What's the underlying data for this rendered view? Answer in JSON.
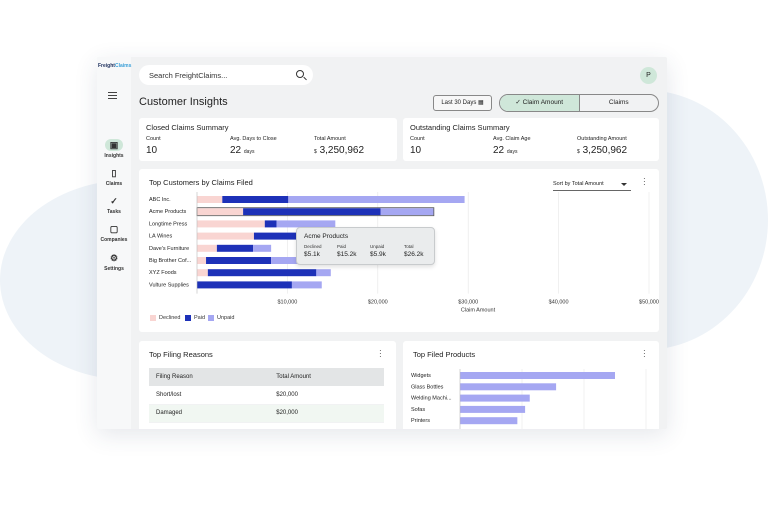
{
  "app": {
    "logo_text": "Freight",
    "logo_accent": "Claims"
  },
  "sidebar": {
    "items": [
      {
        "label": "Insights",
        "icon": "chart-icon",
        "active": true
      },
      {
        "label": "Claims",
        "icon": "clipboard-icon",
        "active": false
      },
      {
        "label": "Tasks",
        "icon": "check-icon",
        "active": false
      },
      {
        "label": "Companies",
        "icon": "briefcase-icon",
        "active": false
      },
      {
        "label": "Settings",
        "icon": "gear-icon",
        "active": false
      }
    ]
  },
  "header": {
    "search_placeholder": "Search FreightClaims...",
    "avatar_initial": "P"
  },
  "page": {
    "title": "Customer Insights",
    "date_range": "Last 30 Days",
    "toggle": {
      "active": "Claim Amount",
      "inactive": "Claims"
    }
  },
  "closed_summary": {
    "title": "Closed Claims Summary",
    "count_label": "Count",
    "count_value": "10",
    "avg_label": "Avg. Days to Close",
    "avg_value": "22",
    "avg_unit": "days",
    "total_label": "Total Amount",
    "total_currency": "$",
    "total_value": "3,250,962"
  },
  "outstanding_summary": {
    "title": "Outstanding Claims Summary",
    "count_label": "Count",
    "count_value": "10",
    "age_label": "Avg. Claim Age",
    "age_value": "22",
    "age_unit": "days",
    "amount_label": "Outstanding Amount",
    "amount_currency": "$",
    "amount_value": "3,250,962"
  },
  "top_customers": {
    "title": "Top Customers by Claims Filed",
    "sort_label": "Sort by Total Amount"
  },
  "chart_data": [
    {
      "type": "bar",
      "orientation": "horizontal",
      "stacked": true,
      "title": "Top Customers by Claims Filed",
      "xlabel": "Claim Amount",
      "ylabel": "",
      "categories": [
        "ABC Inc.",
        "Acme Products",
        "Longtime Press",
        "LA Wines",
        "Dave's Furniture",
        "Big Brother Cof...",
        "XYZ Foods",
        "Vulture Supplies"
      ],
      "series": [
        {
          "name": "Declined",
          "color": "#f9d5d2",
          "values": [
            2800,
            5100,
            7500,
            6300,
            2200,
            1000,
            1200,
            0
          ]
        },
        {
          "name": "Paid",
          "color": "#1d31b8",
          "values": [
            7300,
            15200,
            1300,
            6800,
            4000,
            7200,
            12000,
            10500
          ]
        },
        {
          "name": "Unpaid",
          "color": "#a5a7f2",
          "values": [
            19500,
            5900,
            6500,
            2400,
            2000,
            4700,
            1600,
            3300
          ]
        }
      ],
      "xlim": [
        0,
        50000
      ],
      "xticks": [
        "$10,000",
        "$20,000",
        "$30,000",
        "$40,000",
        "$50,000"
      ],
      "grid": true,
      "legend": "bottom-left",
      "tooltip": {
        "title": "Acme Products",
        "items": [
          {
            "label": "Declined",
            "value": "$5.1k"
          },
          {
            "label": "Paid",
            "value": "$15.2k"
          },
          {
            "label": "Unpaid",
            "value": "$5.9k"
          },
          {
            "label": "Total",
            "value": "$26.2k"
          }
        ]
      }
    },
    {
      "type": "bar",
      "orientation": "horizontal",
      "title": "Top Filed Products",
      "categories": [
        "Widgets",
        "Glass Bottles",
        "Welding Machi...",
        "Sofas",
        "Printers"
      ],
      "series": [
        {
          "color": "#a5a7f2",
          "values": [
            100,
            62,
            45,
            42,
            37
          ]
        }
      ],
      "xlim": [
        0,
        120
      ]
    }
  ],
  "filing_reasons": {
    "title": "Top Filing Reasons",
    "columns": [
      "Filing Reason",
      "Total Amount"
    ],
    "rows": [
      {
        "reason": "Short/lost",
        "amount": "$20,000"
      },
      {
        "reason": "Damaged",
        "amount": "$20,000"
      }
    ]
  },
  "top_products": {
    "title": "Top Filed Products"
  }
}
